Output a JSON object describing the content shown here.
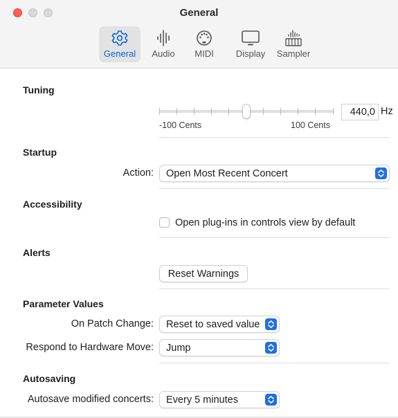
{
  "window": {
    "title": "General",
    "colors": {
      "close": "#ff5f57",
      "accent": "#1f6fe5",
      "active_tab_text": "#0a64d6"
    }
  },
  "toolbar": {
    "tabs": [
      {
        "label": "General",
        "icon": "gear-icon",
        "active": true
      },
      {
        "label": "Audio",
        "icon": "audio-waveform-icon",
        "active": false
      },
      {
        "label": "MIDI",
        "icon": "midi-connector-icon",
        "active": false
      },
      {
        "label": "Display",
        "icon": "monitor-icon",
        "active": false
      },
      {
        "label": "Sampler",
        "icon": "sampler-keyboard-icon",
        "active": false
      }
    ]
  },
  "tuning": {
    "title": "Tuning",
    "slider_min_label": "-100 Cents",
    "slider_max_label": "100 Cents",
    "slider_value_fraction": 0.5,
    "frequency_value": "440,0",
    "frequency_unit": "Hz"
  },
  "startup": {
    "title": "Startup",
    "action_label": "Action:",
    "action_value": "Open Most Recent Concert"
  },
  "accessibility": {
    "title": "Accessibility",
    "checkbox_label": "Open plug-ins in controls view by default",
    "checked": false
  },
  "alerts": {
    "title": "Alerts",
    "reset_button_label": "Reset Warnings"
  },
  "parameter_values": {
    "title": "Parameter Values",
    "patch_change_label": "On Patch Change:",
    "patch_change_value": "Reset to saved value",
    "hardware_move_label": "Respond to Hardware Move:",
    "hardware_move_value": "Jump"
  },
  "autosaving": {
    "title": "Autosaving",
    "autosave_label": "Autosave modified concerts:",
    "autosave_value": "Every 5 minutes"
  }
}
